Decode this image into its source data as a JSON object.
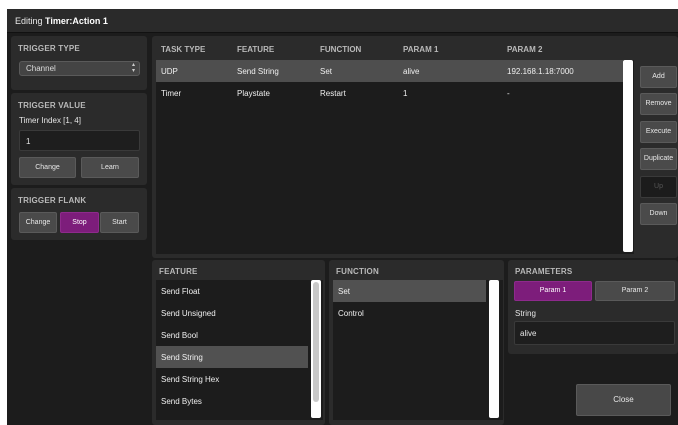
{
  "window": {
    "title_prefix": "Editing ",
    "title_bold": "Timer:Action 1"
  },
  "trigger_type": {
    "heading": "TRIGGER TYPE",
    "selected": "Channel"
  },
  "trigger_value": {
    "heading": "TRIGGER VALUE",
    "label": "Timer Index [1, 4]",
    "value": "1",
    "change_label": "Change",
    "learn_label": "Learn"
  },
  "trigger_flank": {
    "heading": "TRIGGER FLANK",
    "buttons": [
      "Change",
      "Stop",
      "Start"
    ],
    "active": "Stop"
  },
  "tasks": {
    "columns": [
      "TASK TYPE",
      "FEATURE",
      "FUNCTION",
      "PARAM 1",
      "PARAM 2"
    ],
    "rows": [
      {
        "task_type": "UDP",
        "feature": "Send String",
        "function": "Set",
        "param1": "alive",
        "param2": "192.168.1.18:7000",
        "selected": true
      },
      {
        "task_type": "Timer",
        "feature": "Playstate",
        "function": "Restart",
        "param1": "1",
        "param2": "-",
        "selected": false
      }
    ]
  },
  "actions": {
    "add": "Add",
    "remove": "Remove",
    "execute": "Execute",
    "duplicate": "Duplicate",
    "up": "Up",
    "down": "Down"
  },
  "feature": {
    "heading": "FEATURE",
    "items": [
      "Send Float",
      "Send Unsigned",
      "Send Bool",
      "Send String",
      "Send String Hex",
      "Send Bytes"
    ],
    "selected": "Send String"
  },
  "function": {
    "heading": "FUNCTION",
    "items": [
      "Set",
      "Control"
    ],
    "selected": "Set"
  },
  "parameters": {
    "heading": "PARAMETERS",
    "tab1": "Param 1",
    "tab2": "Param 2",
    "label": "String",
    "value": "alive"
  },
  "close_label": "Close",
  "colors": {
    "accent": "#7d1d7b",
    "background": "#1c1c1c",
    "panel": "#2b2b2b",
    "selection": "#4e4e4e"
  }
}
